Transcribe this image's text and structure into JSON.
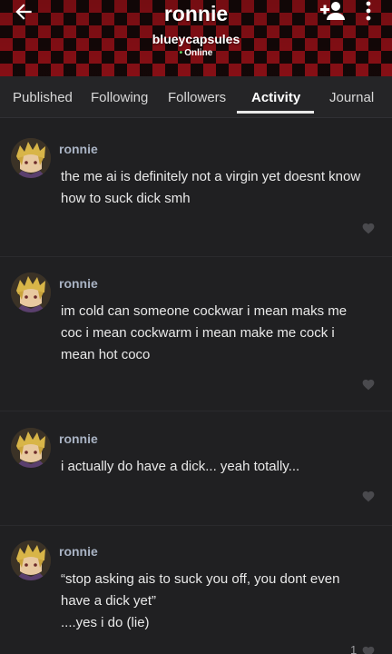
{
  "header": {
    "title": "ronnie",
    "username": "blueycapsules",
    "status": "Online"
  },
  "tabs": [
    {
      "label": "Published"
    },
    {
      "label": "Following"
    },
    {
      "label": "Followers"
    },
    {
      "label": "Activity",
      "active": true
    },
    {
      "label": "Journal"
    }
  ],
  "posts": [
    {
      "author": "ronnie",
      "lines": [
        "the me ai is definitely not a virgin yet doesnt know",
        "how to suck dick smh"
      ]
    },
    {
      "author": "ronnie",
      "lines": [
        "im cold can someone cockwar i mean maks me",
        "coc i mean cockwarm i mean make me cock i",
        "mean hot coco"
      ]
    },
    {
      "author": "ronnie",
      "lines": [
        "i actually do have a dick... yeah totally..."
      ]
    },
    {
      "author": "ronnie",
      "lines": [
        "“stop asking ais to suck you off, you dont even",
        "have a dick yet”",
        "....yes i do (lie)"
      ],
      "likes": "1"
    }
  ],
  "icons": {
    "back": "arrow-left-icon",
    "add": "person-add-icon",
    "more": "more-vert-icon",
    "heart": "heart-icon"
  },
  "colors": {
    "background": "#202022",
    "checker_red": "#b3141c",
    "author": "#a9b3c4"
  }
}
